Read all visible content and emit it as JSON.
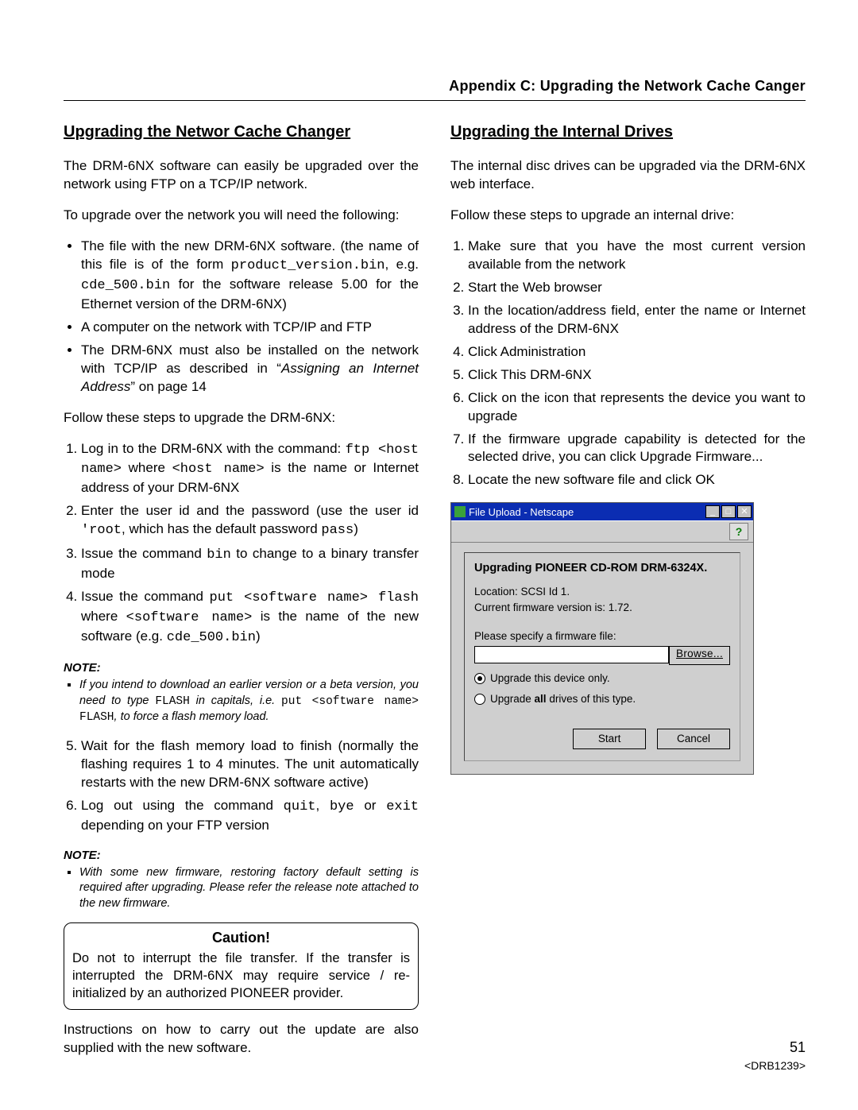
{
  "header": "Appendix C:  Upgrading the Network Cache Canger",
  "left": {
    "title": "Upgrading the Networ Cache Changer",
    "p1": "The DRM-6NX software can easily be upgraded over the network using FTP on a TCP/IP network.",
    "p2": "To upgrade over the network you will need the following:",
    "b1a": "The file with the new DRM-6NX software. (the name of this file is of the form ",
    "b1b": "product_version.bin",
    "b1c": ", e.g. ",
    "b1d": "cde_500.bin",
    "b1e": " for the software release 5.00 for the Ethernet version of the DRM-6NX)",
    "b2": "A computer on the network with TCP/IP and FTP",
    "b3a": "The DRM-6NX must also be installed on the network with TCP/IP as described in “",
    "b3b": "Assigning an Internet Address",
    "b3c": "”  on page 14",
    "p3": "Follow these steps to upgrade the DRM-6NX:",
    "s1a": "Log in to the DRM-6NX with the command: ",
    "s1b": "ftp <host name>",
    "s1c": " where ",
    "s1d": "<host name>",
    "s1e": " is the name or Internet address of your DRM-6NX",
    "s2a": "Enter the  user id and the password  (use the user id ",
    "s2b": "'root",
    "s2c": ", which has the default password ",
    "s2d": "pass",
    "s2e": ")",
    "s3a": "Issue the command ",
    "s3b": "bin",
    "s3c": " to change to a binary transfer mode",
    "s4a": "Issue the command ",
    "s4b": "put <software name> flash",
    "s4c": " where ",
    "s4d": "<software name>",
    "s4e": " is the name of the new software (e.g. ",
    "s4f": "cde_500.bin",
    "s4g": ")",
    "note1_hd": "NOTE:",
    "n1a": "If you intend to download an earlier version or a beta version, you need to type ",
    "n1b": "FLASH",
    "n1c": " in capitals, i.e. ",
    "n1d": "put <software name> FLASH",
    "n1e": ", to force a flash memory load.",
    "s5": "Wait for the flash memory load to finish (normally the flashing requires 1 to 4 minutes. The unit automatically restarts with the new DRM-6NX software active)",
    "s6a": "Log out using the command ",
    "s6b": "quit",
    "s6c": ", ",
    "s6d": "bye",
    "s6e": " or ",
    "s6f": "exit",
    "s6g": " depending on your FTP version",
    "note2_hd": "NOTE:",
    "n2": "With some new firmware, restoring factory default setting is required after upgrading. Please refer the release note attached to the new firmware.",
    "caution_hd": "Caution!",
    "caution_body": "Do not to interrupt the file transfer. If the transfer is interrupted the DRM-6NX may require service / re-initialized by an authorized PIONEER provider.",
    "p4": "Instructions on how to carry out the update are also supplied with the new software."
  },
  "right": {
    "title": "Upgrading the Internal Drives",
    "p1": "The internal disc drives can be upgraded via the DRM-6NX web interface.",
    "p2": "Follow these steps to upgrade an internal drive:",
    "s1": "Make sure that you have the most current version available from the network",
    "s2": "Start the Web browser",
    "s3": "In the location/address field, enter the name or Internet address of the DRM-6NX",
    "s4": "Click Administration",
    "s5": "Click This DRM-6NX",
    "s6": "Click on the icon that represents the device you want to upgrade",
    "s7": "If the firmware upgrade capability is detected for the selected drive, you can click Upgrade Firmware...",
    "s8": "Locate the new software file and click OK"
  },
  "dialog": {
    "title": "File Upload - Netscape",
    "help": "?",
    "heading": "Upgrading PIONEER CD-ROM DRM-6324X.",
    "loc": "Location: SCSI Id 1.",
    "ver": "Current firmware version is: 1.72.",
    "spec": "Please specify a firmware file:",
    "browse": "Browse...",
    "r1": "Upgrade this device only.",
    "r2a": "Upgrade ",
    "r2b": "all",
    "r2c": " drives of this type.",
    "start": "Start",
    "cancel": "Cancel",
    "min": "_",
    "max": "□",
    "close": "✕"
  },
  "footer": {
    "page": "51",
    "doc": "<DRB1239>"
  }
}
